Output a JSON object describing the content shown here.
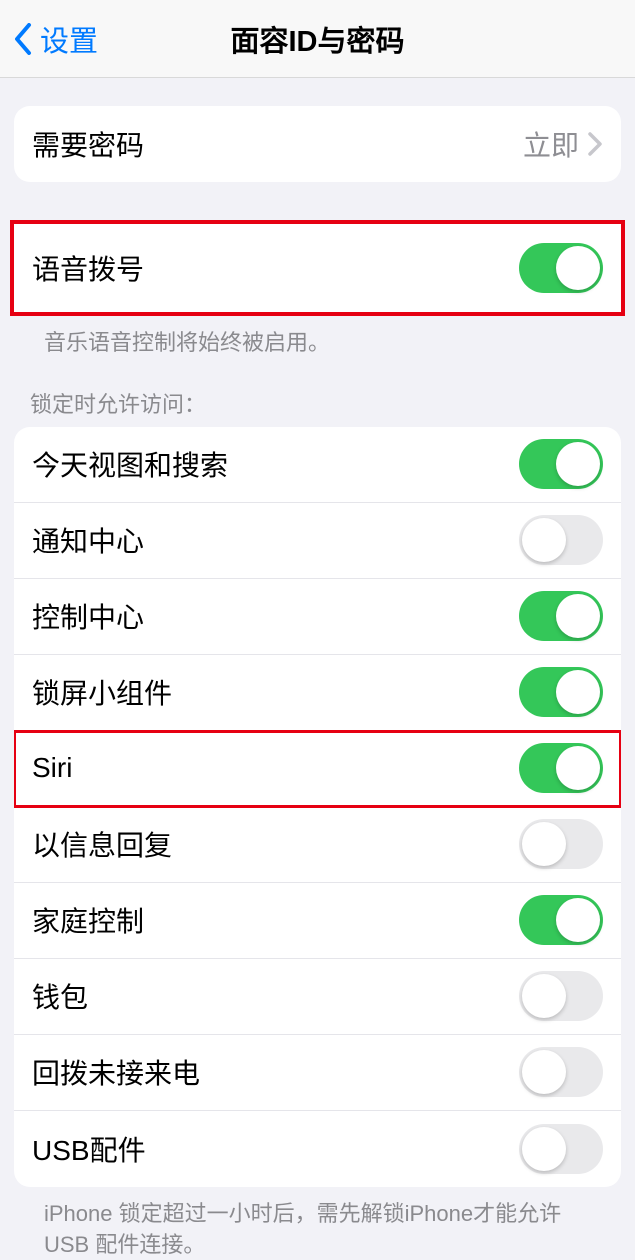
{
  "header": {
    "back_label": "设置",
    "title": "面容ID与密码"
  },
  "passcode_row": {
    "label": "需要密码",
    "value": "立即"
  },
  "voice_dial": {
    "label": "语音拨号",
    "on": true,
    "footer": "音乐语音控制将始终被启用。"
  },
  "lock_access": {
    "header": "锁定时允许访问：",
    "items": [
      {
        "label": "今天视图和搜索",
        "on": true
      },
      {
        "label": "通知中心",
        "on": false
      },
      {
        "label": "控制中心",
        "on": true
      },
      {
        "label": "锁屏小组件",
        "on": true
      },
      {
        "label": "Siri",
        "on": true,
        "highlight": true
      },
      {
        "label": "以信息回复",
        "on": false
      },
      {
        "label": "家庭控制",
        "on": true
      },
      {
        "label": "钱包",
        "on": false
      },
      {
        "label": "回拨未接来电",
        "on": false
      },
      {
        "label": "USB配件",
        "on": false
      }
    ],
    "footer": "iPhone 锁定超过一小时后，需先解锁iPhone才能允许USB 配件连接。"
  }
}
